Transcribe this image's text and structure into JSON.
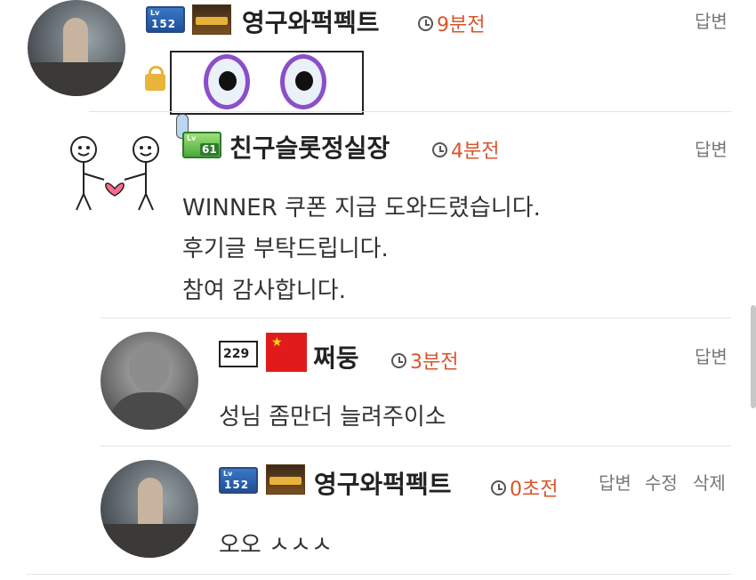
{
  "comments": [
    {
      "nickname": "영구와퍽펙트",
      "time": "9분전",
      "actions": [
        "답변"
      ],
      "level": "152"
    },
    {
      "nickname": "친구슬롯정실장",
      "time": "4분전",
      "actions": [
        "답변"
      ],
      "level": "61",
      "lines": [
        "WINNER 쿠폰 지급 도와드렸습니다.",
        "후기글 부탁드립니다.",
        "참여 감사합니다."
      ]
    },
    {
      "nickname": "쩌둥",
      "time": "3분전",
      "actions": [
        "답변"
      ],
      "level": "229",
      "lines": [
        "성님 좀만더 늘려주이소"
      ]
    },
    {
      "nickname": "영구와퍽펙트",
      "time": "0초전",
      "actions": [
        "답변",
        "수정",
        "삭제"
      ],
      "level": "152",
      "lines": [
        "오오 ㅅㅅㅅ"
      ]
    }
  ],
  "colors": {
    "time": "#d9542c",
    "accent_level_blue": "#1f4f96",
    "accent_level_green": "#49a93a"
  },
  "icons": [
    "clock-icon",
    "lock-icon",
    "china-flag-icon",
    "reply-button"
  ]
}
